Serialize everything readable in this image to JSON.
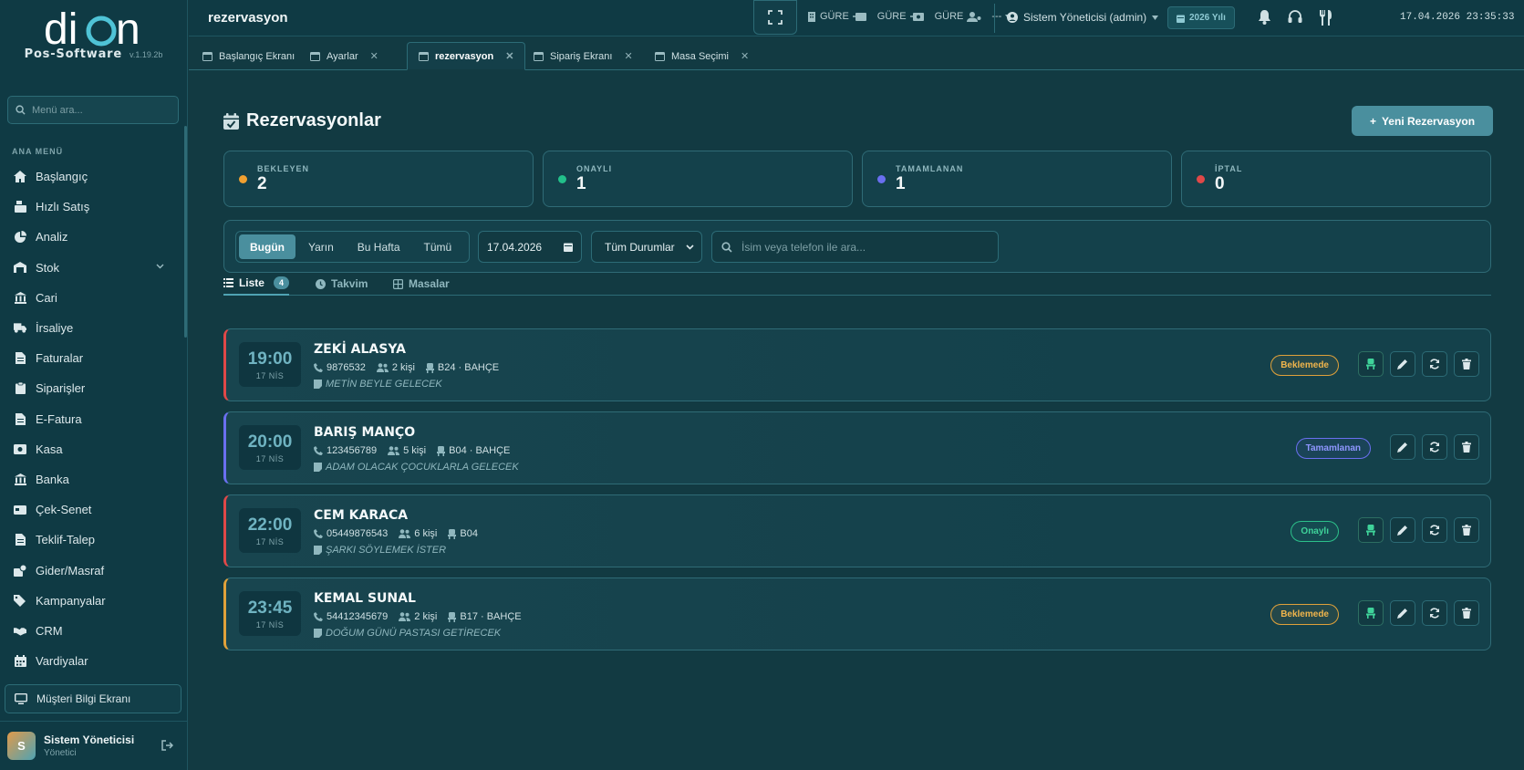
{
  "sidebar": {
    "brand_name": "Pos-Software",
    "version": "v.1.19.2b",
    "search_placeholder": "Menü ara...",
    "section_label": "ANA MENÜ",
    "items": [
      {
        "label": "Başlangıç",
        "icon": "home-icon"
      },
      {
        "label": "Hızlı Satış",
        "icon": "cash-register-icon"
      },
      {
        "label": "Analiz",
        "icon": "pie-chart-icon"
      },
      {
        "label": "Stok",
        "icon": "warehouse-icon"
      },
      {
        "label": "Cari",
        "icon": "bank-icon"
      },
      {
        "label": "İrsaliye",
        "icon": "truck-icon"
      },
      {
        "label": "Faturalar",
        "icon": "file-icon"
      },
      {
        "label": "Siparişler",
        "icon": "clipboard-icon"
      },
      {
        "label": "E-Fatura",
        "icon": "file-icon"
      },
      {
        "label": "Kasa",
        "icon": "money-icon"
      },
      {
        "label": "Banka",
        "icon": "bank-icon"
      },
      {
        "label": "Çek-Senet",
        "icon": "card-icon"
      },
      {
        "label": "Teklif-Talep",
        "icon": "file-icon"
      },
      {
        "label": "Gider/Masraf",
        "icon": "expense-icon"
      },
      {
        "label": "Kampanyalar",
        "icon": "tags-icon"
      },
      {
        "label": "CRM",
        "icon": "handshake-icon"
      },
      {
        "label": "Vardiyalar",
        "icon": "calendar-icon"
      }
    ],
    "customer_screen": "Müşteri Bilgi Ekranı",
    "user": {
      "initial": "S",
      "name": "Sistem Yöneticisi",
      "role": "Yönetici"
    }
  },
  "topbar": {
    "title": "rezervasyon",
    "status_items": [
      "GÜRE",
      "GÜRE",
      "GÜRE",
      "---"
    ],
    "admin": "Sistem Yöneticisi (admin)",
    "year": "2026 Yılı",
    "datetime": "17.04.2026 23:35:33"
  },
  "tabs": [
    {
      "label": "Başlangıç Ekranı",
      "closable": false
    },
    {
      "label": "Ayarlar",
      "closable": true
    },
    {
      "label": "rezervasyon",
      "closable": true,
      "active": true
    },
    {
      "label": "Sipariş Ekranı",
      "closable": true
    },
    {
      "label": "Masa Seçimi",
      "closable": true
    }
  ],
  "page": {
    "title": "Rezervasyonlar",
    "new_button": "Yeni Rezervasyon",
    "stats": [
      {
        "label": "BEKLEYEN",
        "value": "2",
        "color": "#f0a030"
      },
      {
        "label": "ONAYLI",
        "value": "1",
        "color": "#22c08a"
      },
      {
        "label": "TAMAMLANAN",
        "value": "1",
        "color": "#6a6ff0"
      },
      {
        "label": "İPTAL",
        "value": "0",
        "color": "#e04848"
      }
    ],
    "filters": {
      "periods": [
        "Bugün",
        "Yarın",
        "Bu Hafta",
        "Tümü"
      ],
      "active_period": "Bugün",
      "date": "17.04.2026",
      "status": "Tüm Durumlar",
      "search_placeholder": "İsim veya telefon ile ara..."
    },
    "views": [
      {
        "label": "Liste",
        "count": "4"
      },
      {
        "label": "Takvim"
      },
      {
        "label": "Masalar"
      }
    ]
  },
  "reservations": [
    {
      "time": "19:00",
      "date": "17 NİS",
      "name": "ZEKİ ALASYA",
      "phone": "9876532",
      "people": "2 kişi",
      "table": "B24 · BAHÇE",
      "note": "METİN BEYLE GELECEK",
      "status": "Beklemede",
      "status_type": "pending",
      "accent": "#e04848"
    },
    {
      "time": "20:00",
      "date": "17 NİS",
      "name": "BARIŞ MANÇO",
      "phone": "123456789",
      "people": "5 kişi",
      "table": "B04 · BAHÇE",
      "note": "ADAM OLACAK ÇOCUKLARLA GELECEK",
      "status": "Tamamlanan",
      "status_type": "done",
      "accent": "#6a6ff0"
    },
    {
      "time": "22:00",
      "date": "17 NİS",
      "name": "CEM KARACA",
      "phone": "05449876543",
      "people": "6 kişi",
      "table": "B04",
      "note": "ŞARKI SÖYLEMEK İSTER",
      "status": "Onaylı",
      "status_type": "ok",
      "accent": "#e04848"
    },
    {
      "time": "23:45",
      "date": "17 NİS",
      "name": "KEMAL SUNAL",
      "phone": "54412345679",
      "people": "2 kişi",
      "table": "B17 · BAHÇE",
      "note": "DOĞUM GÜNÜ PASTASI GETİRECEK",
      "status": "Beklemede",
      "status_type": "pending",
      "accent": "#e0a13a"
    }
  ]
}
